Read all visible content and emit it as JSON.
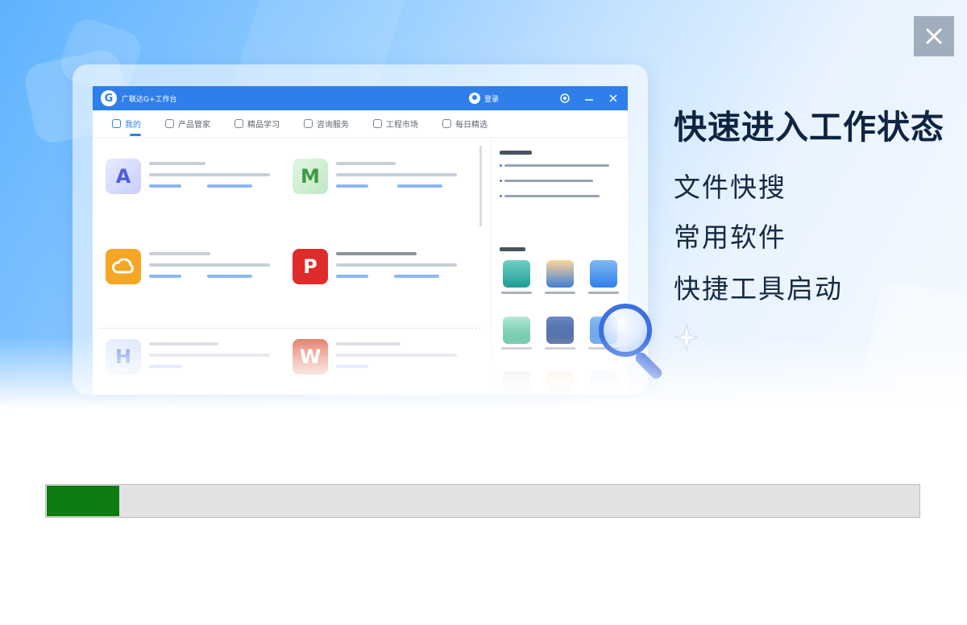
{
  "hero": {
    "headline": "快速进入工作状态",
    "features": [
      "文件快搜",
      "常用软件",
      "快捷工具启动"
    ]
  },
  "mock_window": {
    "title": "广联达G+工作台",
    "login_label": "登录",
    "tabs": [
      {
        "label": "我的",
        "active": true
      },
      {
        "label": "产品管家",
        "active": false
      },
      {
        "label": "精品学习",
        "active": false
      },
      {
        "label": "咨询服务",
        "active": false
      },
      {
        "label": "工程市场",
        "active": false
      },
      {
        "label": "每日精选",
        "active": false
      }
    ]
  },
  "progress": {
    "value": 0.083,
    "fill_color": "#0d7c13",
    "track_color": "#e2e2e2"
  },
  "colors": {
    "accent": "#2f7fea",
    "headline": "#0f2442"
  },
  "icons": {
    "close": "close-icon",
    "search": "magnifier-icon"
  }
}
